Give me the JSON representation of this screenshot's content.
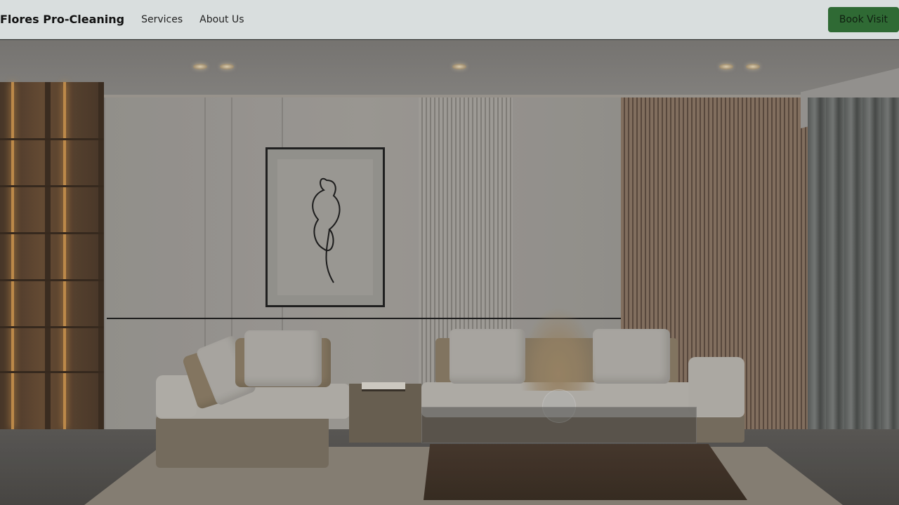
{
  "header": {
    "brand": "Flores Pro-Cleaning",
    "nav_links": [
      {
        "label": "Services"
      },
      {
        "label": "About Us"
      }
    ],
    "cta_label": "Book Visit"
  },
  "colors": {
    "header_bg": "#d9dede",
    "cta_bg": "#2f6a34"
  }
}
